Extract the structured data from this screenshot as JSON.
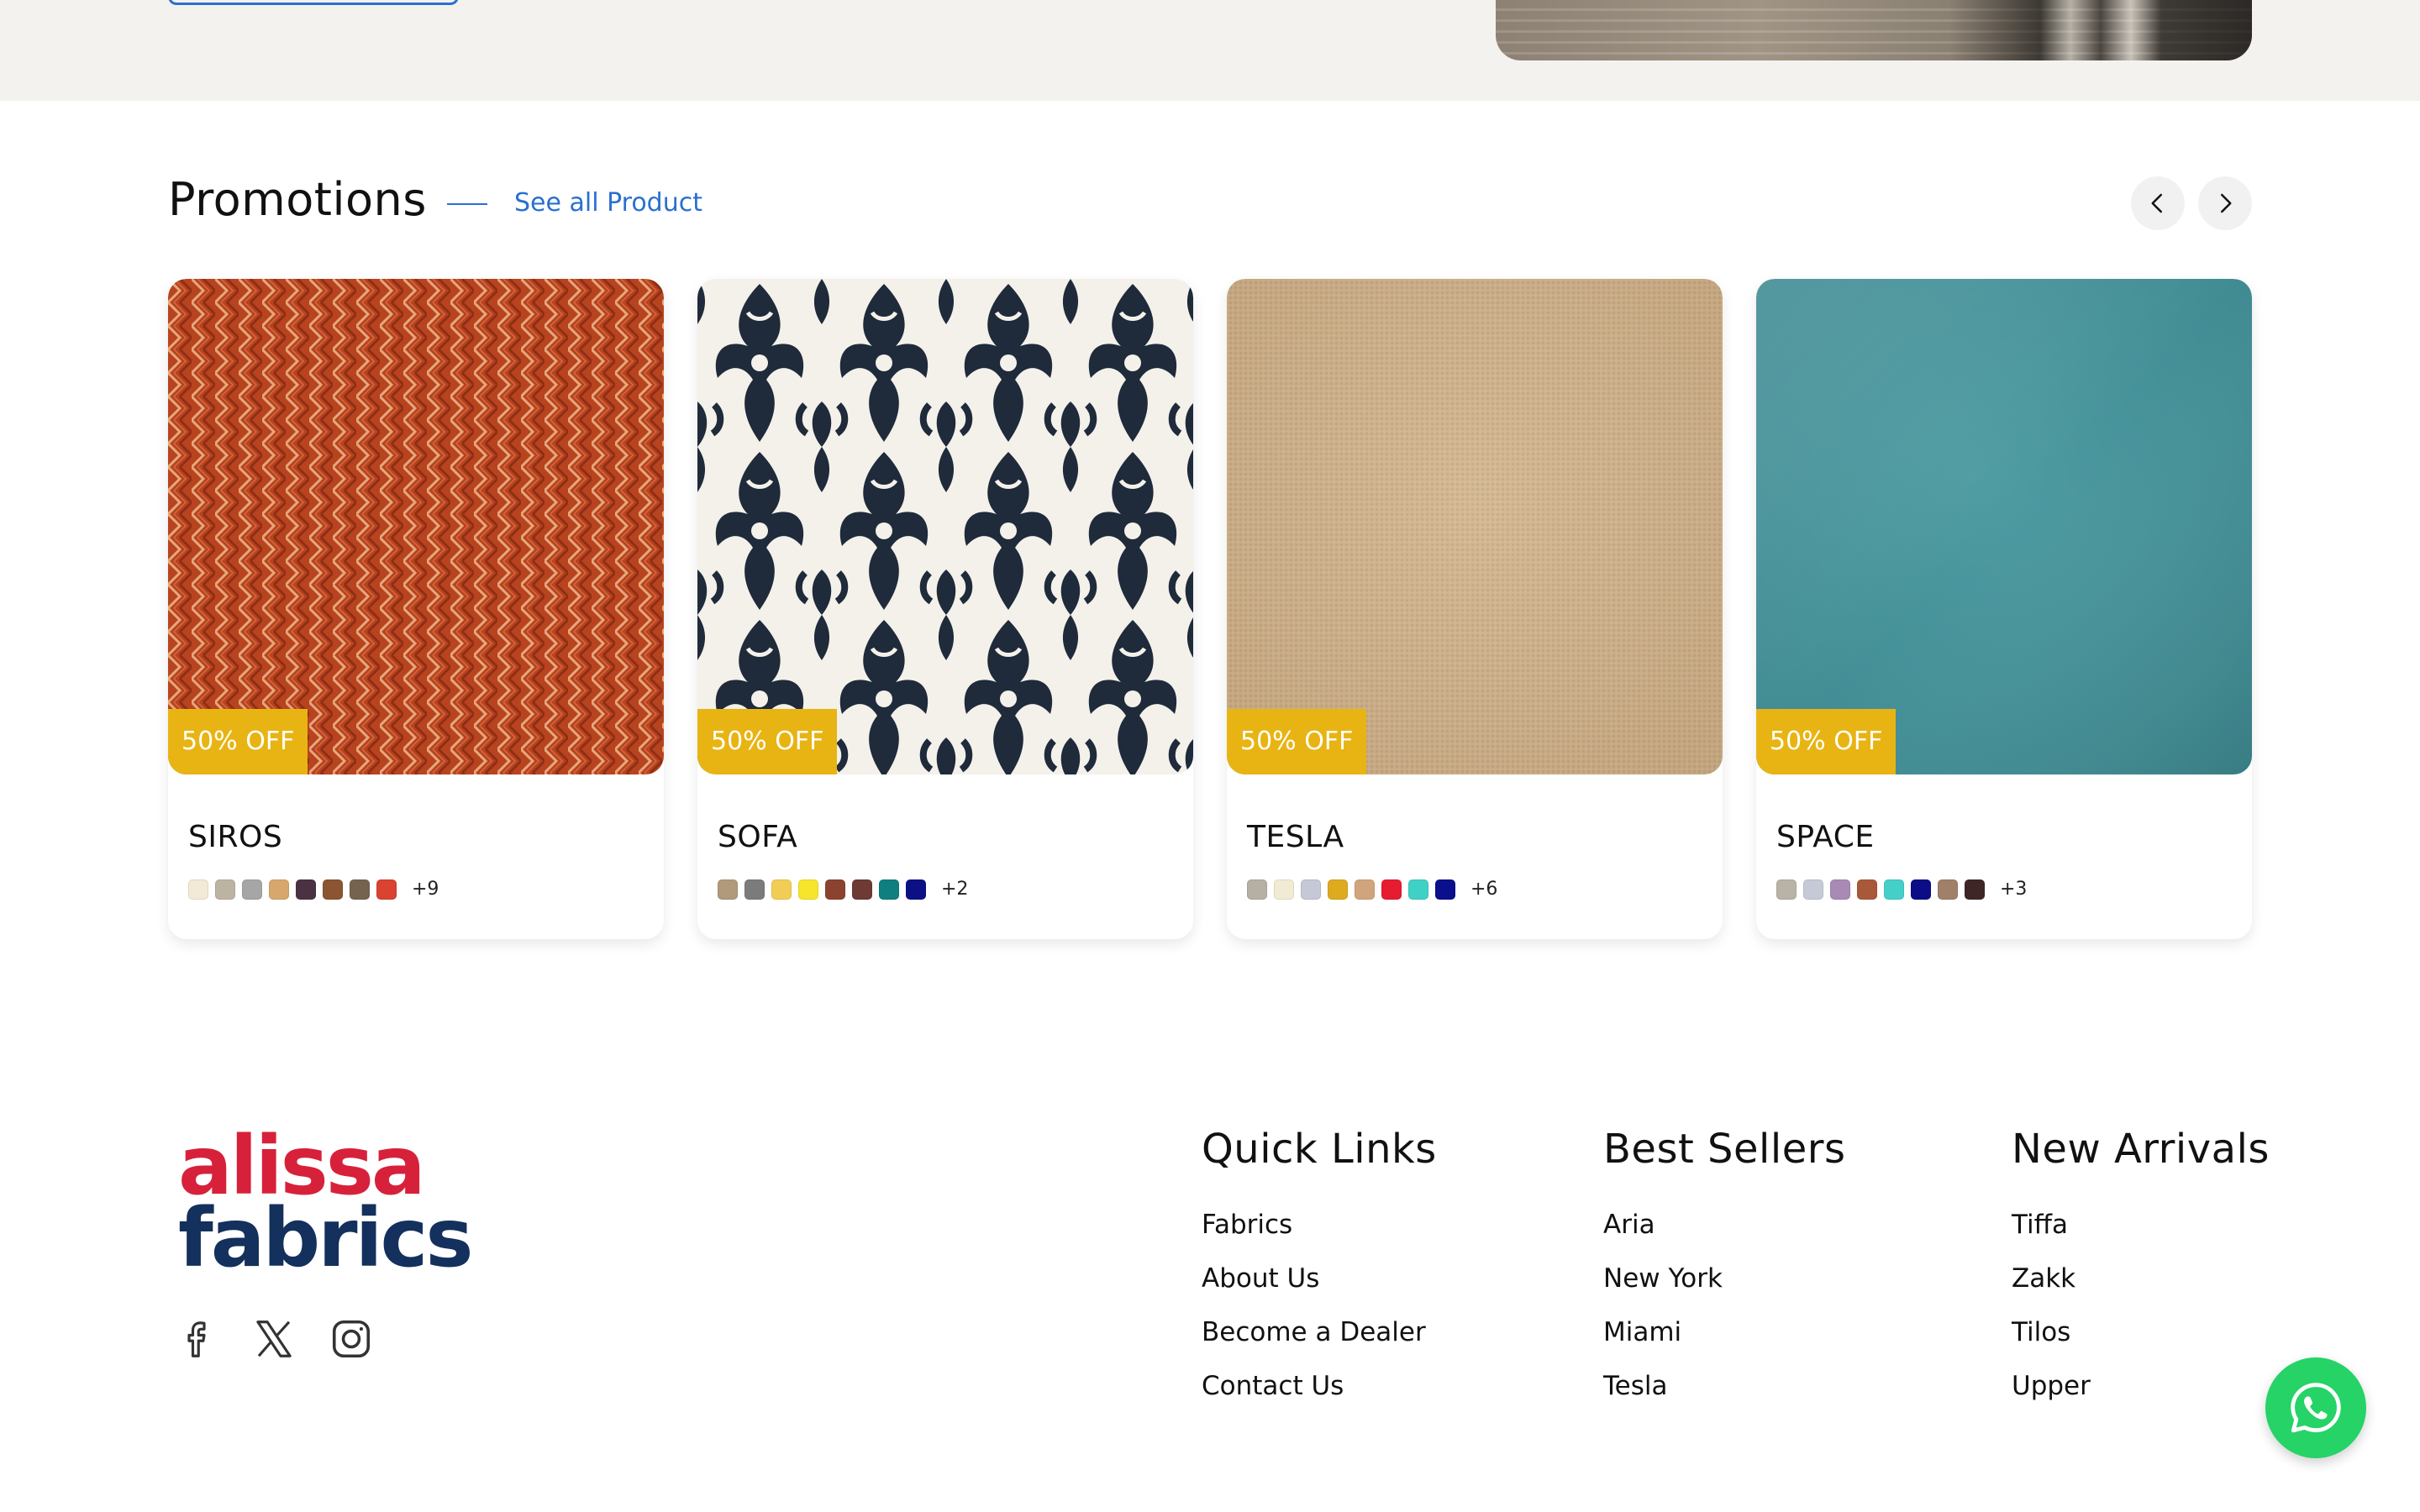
{
  "promotions": {
    "title": "Promotions",
    "see_all_label": "See all Product",
    "prev_icon": "chevron-left-icon",
    "next_icon": "chevron-right-icon"
  },
  "products": [
    {
      "name": "SIROS",
      "badge": "50% OFF",
      "more_colors": "+9",
      "swatches": [
        "#f2ead6",
        "#bdb3a3",
        "#a6a6a6",
        "#d7a76d",
        "#4b3242",
        "#8a5530",
        "#756350",
        "#d9432f"
      ]
    },
    {
      "name": "SOFA",
      "badge": "50% OFF",
      "more_colors": "+2",
      "swatches": [
        "#b09a7b",
        "#7b7b7b",
        "#f2cd56",
        "#f7e52b",
        "#8b4330",
        "#6d3b33",
        "#0f7f7f",
        "#0b1185"
      ]
    },
    {
      "name": "TESLA",
      "badge": "50% OFF",
      "more_colors": "+6",
      "swatches": [
        "#b6afa4",
        "#f1ebd3",
        "#c5c8d6",
        "#ddaa20",
        "#d0a57d",
        "#e61c30",
        "#3fd1c6",
        "#0a0f8c"
      ]
    },
    {
      "name": "SPACE",
      "badge": "50% OFF",
      "more_colors": "+3",
      "swatches": [
        "#b8b2a7",
        "#c6c9d6",
        "#a98ab4",
        "#a8593a",
        "#45cfc9",
        "#0a0d86",
        "#a08069",
        "#3f2626"
      ]
    }
  ],
  "brand": {
    "line1": "alissa",
    "line2": "fabrics",
    "red": "#d7213b",
    "navy": "#14305c"
  },
  "socials": [
    "facebook-icon",
    "x-icon",
    "instagram-icon"
  ],
  "footer": {
    "quick_links": {
      "title": "Quick Links",
      "items": [
        "Fabrics",
        "About Us",
        "Become a Dealer",
        "Contact Us"
      ]
    },
    "best_sellers": {
      "title": "Best Sellers",
      "items": [
        "Aria",
        "New York",
        "Miami",
        "Tesla"
      ]
    },
    "new_arrivals": {
      "title": "New Arrivals",
      "items": [
        "Tiffa",
        "Zakk",
        "Tilos",
        "Upper"
      ]
    }
  },
  "colors": {
    "accent": "#2a6fd1",
    "badge": "#e8b413",
    "whatsapp": "#25d366"
  }
}
